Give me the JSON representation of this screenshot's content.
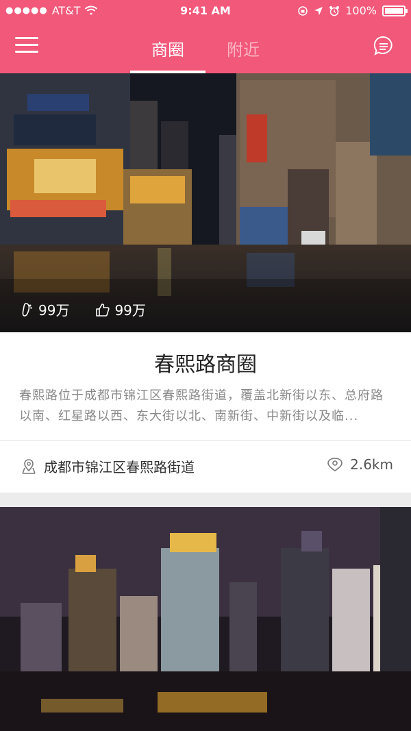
{
  "status_bar": {
    "carrier": "AT&T",
    "time": "9:41 AM",
    "battery": "100%",
    "battery_level": 1.0
  },
  "nav": {
    "tabs": [
      {
        "label": "商圈",
        "active": true
      },
      {
        "label": "附近",
        "active": false
      }
    ],
    "menu_icon": "hamburger-menu-icon",
    "message_icon": "chat-bubble-icon"
  },
  "cards": [
    {
      "image": "night-street-photo",
      "views": "99万",
      "likes": "99万",
      "title": "春熙路商圈",
      "description": "春熙路位于成都市锦江区春熙路街道，覆盖北新街以东、总府路以南、红星路以西、东大街以北、南新街、中新街以及临...",
      "address": "成都市锦江区春熙路街道",
      "distance": "2.6km"
    },
    {
      "image": "night-skyline-photo"
    }
  ],
  "colors": {
    "brand": "#f2587a",
    "inactive_tab": "#fbb4c3",
    "description_text": "#8a8a8a"
  }
}
